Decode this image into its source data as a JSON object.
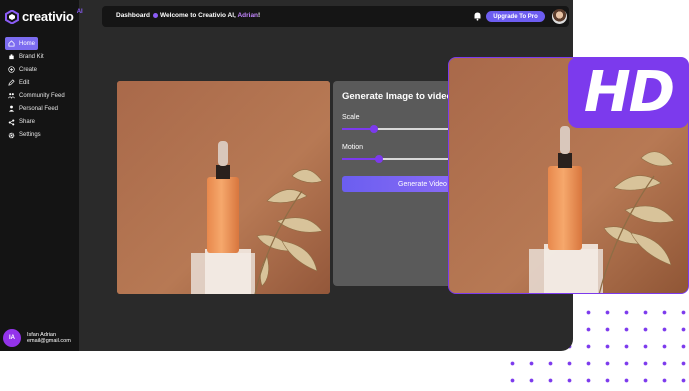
{
  "brand": {
    "name": "creativio",
    "sup": "AI"
  },
  "nav": [
    {
      "label": "Home",
      "icon": "home-icon",
      "active": true
    },
    {
      "label": "Brand Kit",
      "icon": "brand-kit-icon"
    },
    {
      "label": "Create",
      "icon": "plus-circle-icon"
    },
    {
      "label": "Edit",
      "icon": "edit-icon"
    },
    {
      "label": "Community Feed",
      "icon": "community-icon"
    },
    {
      "label": "Personal Feed",
      "icon": "person-icon"
    },
    {
      "label": "Share",
      "icon": "share-icon"
    },
    {
      "label": "Settings",
      "icon": "gear-icon"
    }
  ],
  "user": {
    "initials": "IA",
    "name": "Isfan Adrian",
    "email": "email@gmail.com"
  },
  "topbar": {
    "dashboard": "Dashboard",
    "welcome_prefix": "Welcome to Creativio AI,",
    "welcome_name": "Adrian",
    "welcome_suffix": "!",
    "upgrade_label": "Upgrade To Pro"
  },
  "panel": {
    "title": "Generate Image to video",
    "scale_label": "Scale",
    "scale_value": 0.27,
    "motion_label": "Motion",
    "motion_value": 0.31,
    "generate_label": "Generate Video"
  },
  "overlay": {
    "badge": "HD"
  },
  "colors": {
    "accent": "#7c3aed",
    "button": "#6d5df0",
    "sidebar": "#141414",
    "content": "#2a2a2a"
  }
}
